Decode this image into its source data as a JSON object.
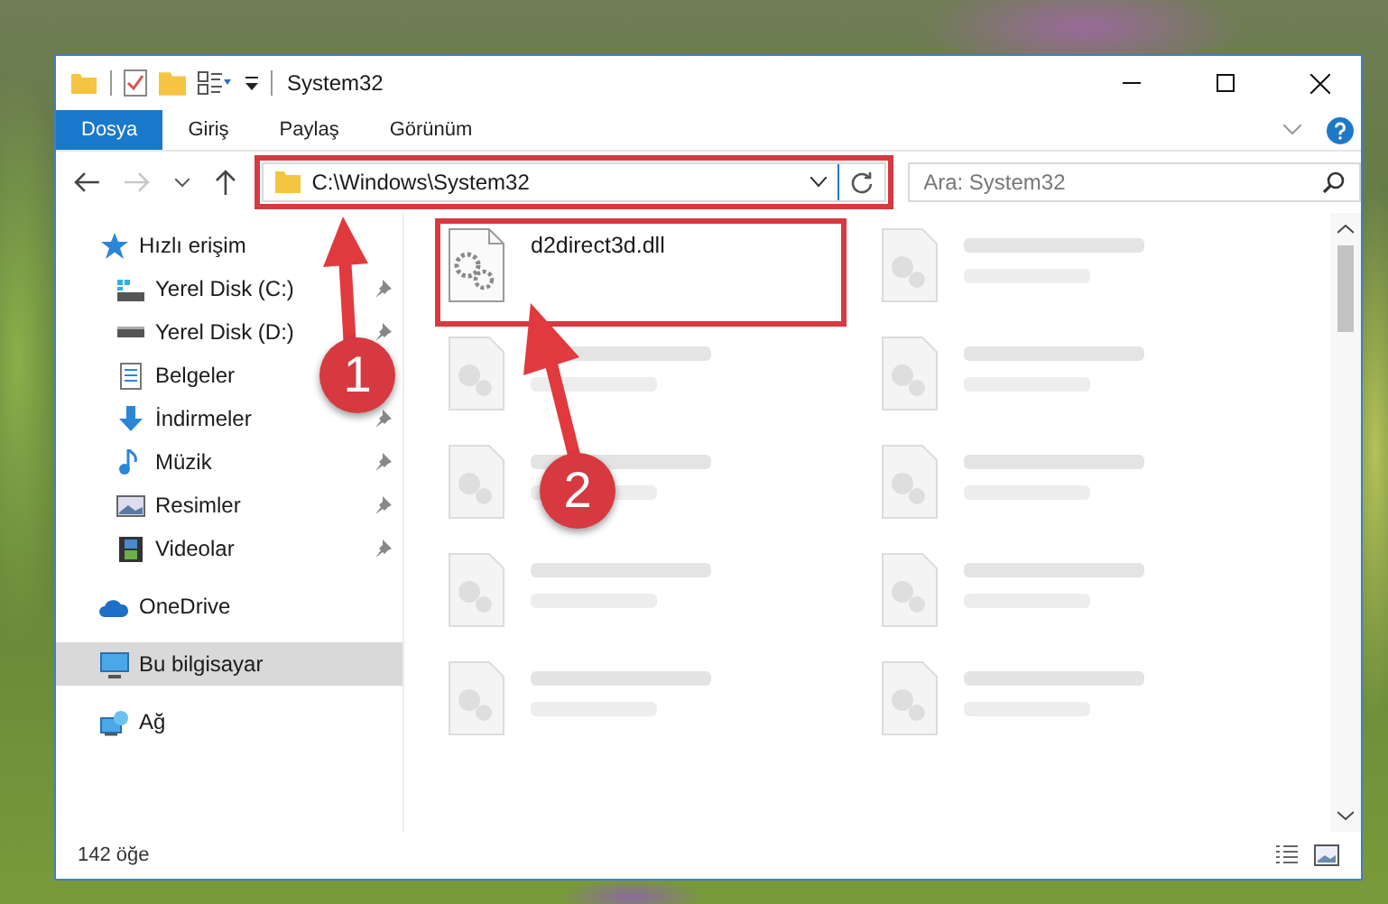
{
  "window": {
    "title": "System32"
  },
  "ribbon_tabs": [
    {
      "label": "Dosya",
      "selected": true
    },
    {
      "label": "Giriş",
      "selected": false
    },
    {
      "label": "Paylaş",
      "selected": false
    },
    {
      "label": "Görünüm",
      "selected": false
    }
  ],
  "address": {
    "path": "C:\\Windows\\System32",
    "highlighted": true
  },
  "search": {
    "placeholder": "Ara: System32"
  },
  "sidebar": {
    "items": [
      {
        "label": "Hızlı erişim",
        "selected": false,
        "children": [
          {
            "label": "Yerel Disk (C:)",
            "selected": false,
            "pinned": true
          },
          {
            "label": "Yerel Disk (D:)",
            "selected": false,
            "pinned": true
          },
          {
            "label": "Belgeler",
            "selected": false
          },
          {
            "label": "İndirmeler",
            "selected": false,
            "pinned": true
          },
          {
            "label": "Müzik",
            "selected": false,
            "pinned": true
          },
          {
            "label": "Resimler",
            "selected": false,
            "pinned": true
          },
          {
            "label": "Videolar",
            "selected": false,
            "pinned": true
          }
        ]
      },
      {
        "label": "OneDrive",
        "selected": false
      },
      {
        "label": "Bu bilgisayar",
        "selected": true
      },
      {
        "label": "Ağ",
        "selected": false
      }
    ]
  },
  "files": [
    {
      "kind": "file",
      "name": "d2direct3d.dll",
      "highlighted": true
    },
    {
      "kind": "blurred"
    },
    {
      "kind": "blurred"
    },
    {
      "kind": "blurred"
    },
    {
      "kind": "blurred"
    },
    {
      "kind": "blurred"
    },
    {
      "kind": "blurred"
    },
    {
      "kind": "blurred"
    },
    {
      "kind": "blurred"
    },
    {
      "kind": "blurred"
    }
  ],
  "annotations": [
    {
      "number": "1"
    },
    {
      "number": "2"
    }
  ],
  "status_bar": {
    "count": "142 öğe"
  }
}
